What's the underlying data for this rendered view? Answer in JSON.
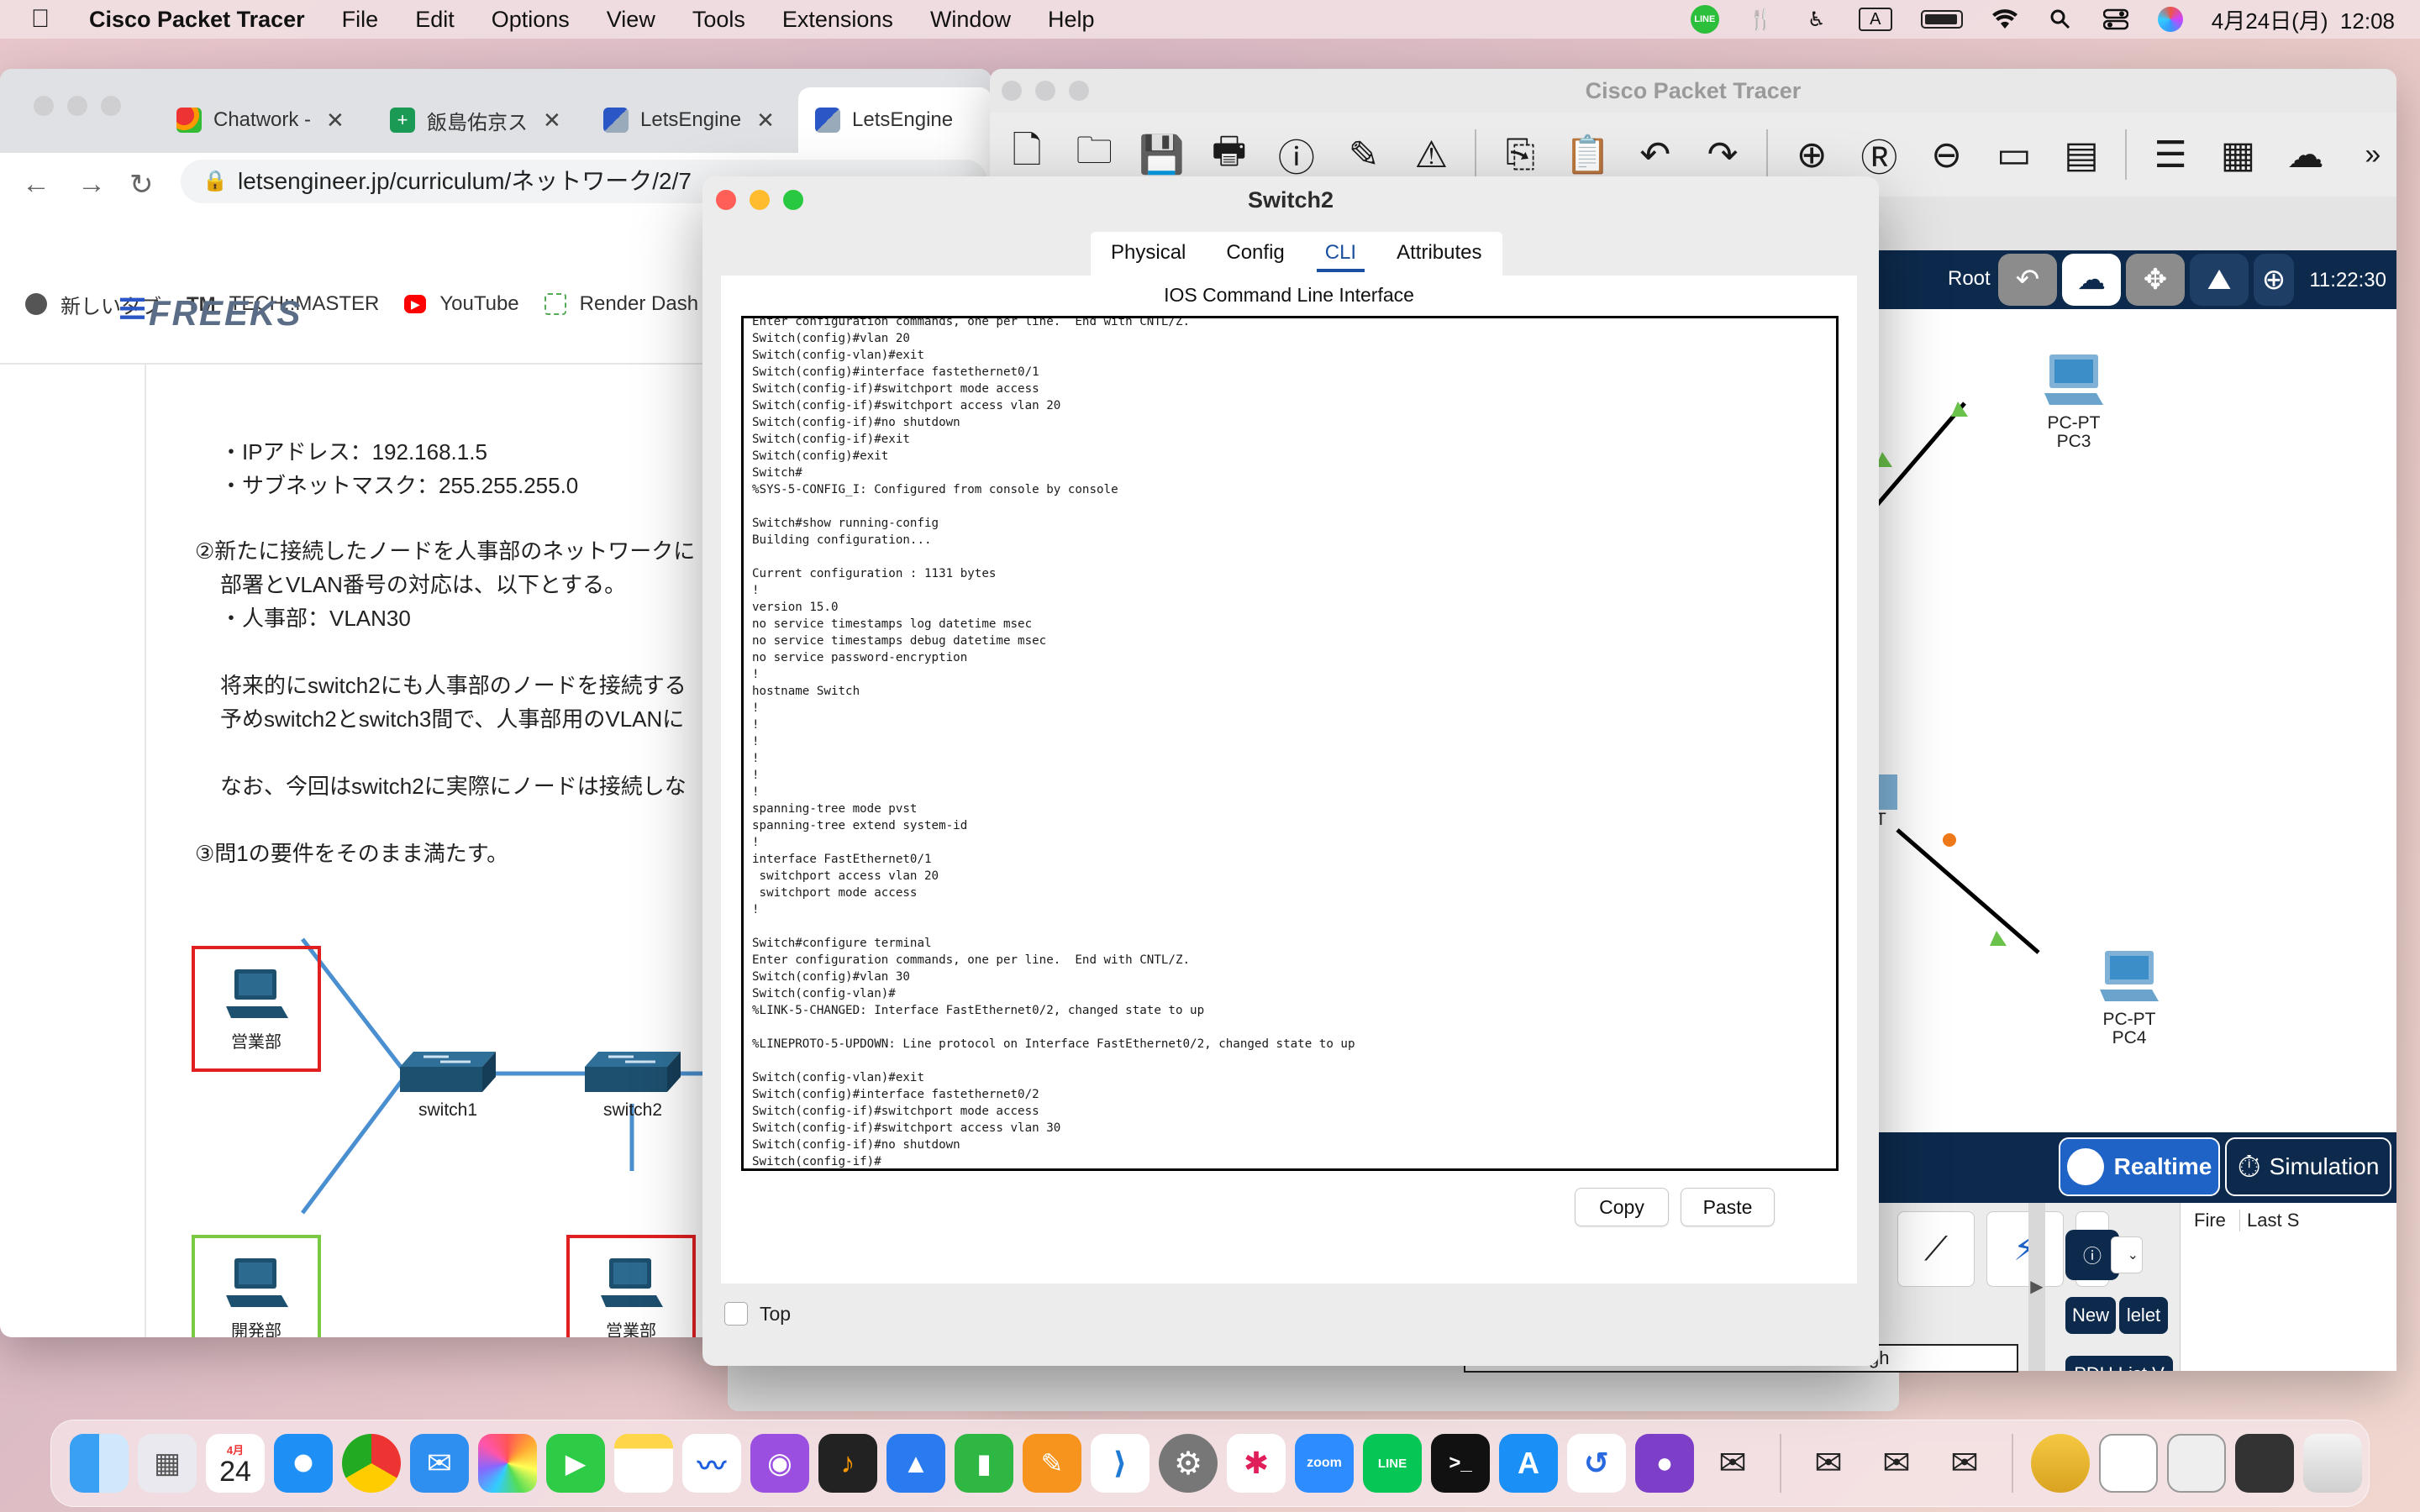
{
  "menubar": {
    "app_name": "Cisco Packet Tracer",
    "menus": [
      "File",
      "Edit",
      "Options",
      "View",
      "Tools",
      "Extensions",
      "Window",
      "Help"
    ],
    "clock": "4月24日(月)  12:08",
    "status_icons": [
      "line-icon",
      "fork-knife-icon",
      "accessibility-icon",
      "input-source-A",
      "battery-icon",
      "wifi-icon",
      "search-icon",
      "control-center-icon",
      "siri-icon"
    ],
    "input_source": "A"
  },
  "browser": {
    "tabs": [
      {
        "label": "Chatwork -",
        "active": false
      },
      {
        "label": "飯島佑京ス",
        "active": false
      },
      {
        "label": "LetsEngine",
        "active": false
      },
      {
        "label": "LetsEngine",
        "active": true
      }
    ],
    "url": "letsengineer.jp/curriculum/ネットワーク/2/7",
    "bookmarks": [
      "新しいタブ",
      "TECH::MASTER",
      "YouTube",
      "Render Dash"
    ],
    "logo": "FREEKS",
    "content_lines": [
      "・IPアドレス：192.168.1.5",
      "・サブネットマスク：255.255.255.0",
      "②新たに接続したノードを人事部のネットワークに",
      "部署とVLAN番号の対応は、以下とする。",
      "・人事部：VLAN30",
      "将来的にswitch2にも人事部のノードを接続する",
      "予めswitch2とswitch3間で、人事部用のVLANに",
      "なお、今回はswitch2に実際にノードは接続しな",
      "③問1の要件をそのまま満たす。"
    ],
    "diagram": {
      "nodes": [
        "営業部",
        "開発部",
        "営業部"
      ],
      "switches": [
        "switch1",
        "switch2"
      ]
    }
  },
  "packet_tracer": {
    "title": "Cisco Packet Tracer",
    "toolbar_icons": [
      "new-file-icon",
      "open-folder-icon",
      "save-icon",
      "print-icon",
      "info-icon",
      "activity-wizard-icon",
      "custom-device-icon",
      "copy-icon",
      "paste-icon",
      "undo-icon",
      "redo-icon",
      "zoom-in-icon",
      "zoom-reset-icon",
      "zoom-out-icon",
      "rectangle-icon",
      "palette-icon",
      "notes-icon",
      "device-dialog-icon",
      "viewport-icon",
      "more-icon"
    ],
    "root_label": "Root",
    "time": "11:22:30",
    "devices": [
      {
        "type": "PC-PT",
        "name": "PC3"
      },
      {
        "type": "PC-PT",
        "name": "PC4"
      }
    ],
    "partial_label": "T",
    "modes": {
      "realtime": "Realtime",
      "simulation": "Simulation"
    },
    "pdu": {
      "fire": "Fire",
      "last": "Last S",
      "new": "New",
      "delete": "lelet",
      "list": "PDU List V"
    },
    "footer_fragment": "gh"
  },
  "switch_dialog": {
    "title": "Switch2",
    "tabs": [
      "Physical",
      "Config",
      "CLI",
      "Attributes"
    ],
    "active_tab": "CLI",
    "heading": "IOS Command Line Interface",
    "cli_text": "Enter configuration commands, one per line.  End with CNTL/Z.\nSwitch(config)#vlan 20\nSwitch(config-vlan)#exit\nSwitch(config)#interface fastethernet0/1\nSwitch(config-if)#switchport mode access\nSwitch(config-if)#switchport access vlan 20\nSwitch(config-if)#no shutdown\nSwitch(config-if)#exit\nSwitch(config)#exit\nSwitch#\n%SYS-5-CONFIG_I: Configured from console by console\n\nSwitch#show running-config\nBuilding configuration...\n\nCurrent configuration : 1131 bytes\n!\nversion 15.0\nno service timestamps log datetime msec\nno service timestamps debug datetime msec\nno service password-encryption\n!\nhostname Switch\n!\n!\n!\n!\n!\n!\nspanning-tree mode pvst\nspanning-tree extend system-id\n!\ninterface FastEthernet0/1\n switchport access vlan 20\n switchport mode access\n!\n\nSwitch#configure terminal\nEnter configuration commands, one per line.  End with CNTL/Z.\nSwitch(config)#vlan 30\nSwitch(config-vlan)#\n%LINK-5-CHANGED: Interface FastEthernet0/2, changed state to up\n\n%LINEPROTO-5-UPDOWN: Line protocol on Interface FastEthernet0/2, changed state to up\n\nSwitch(config-vlan)#exit\nSwitch(config)#interface fastethernet0/2\nSwitch(config-if)#switchport mode access\nSwitch(config-if)#switchport access vlan 30\nSwitch(config-if)#no shutdown\nSwitch(config-if)#",
    "copy": "Copy",
    "paste": "Paste",
    "top_checkbox": "Top"
  },
  "dock": {
    "calendar_month": "4月",
    "calendar_day": "24",
    "zoom": "zoom",
    "line": "LINE",
    "apps": [
      "finder-icon",
      "launchpad-icon",
      "calendar-icon",
      "safari-icon",
      "chrome-icon",
      "mail-icon",
      "photos-icon",
      "facetime-icon",
      "notes-icon",
      "freeform-icon",
      "podcasts-icon",
      "garageband-icon",
      "keynote-icon",
      "numbers-icon",
      "pages-icon",
      "vscode-icon",
      "system-settings-icon",
      "slack-icon",
      "zoom-icon",
      "line-icon",
      "terminal-icon",
      "app-store-icon",
      "cisco-webex-icon",
      "github-desktop-icon",
      "packet-tracer-icon",
      "packet-tracer-icon",
      "packet-tracer-icon",
      "packet-tracer-icon",
      "packet-tracer-icon",
      "database-icon",
      "screenshot-icon",
      "screenshot-icon",
      "screenshot-icon",
      "trash-icon"
    ]
  }
}
